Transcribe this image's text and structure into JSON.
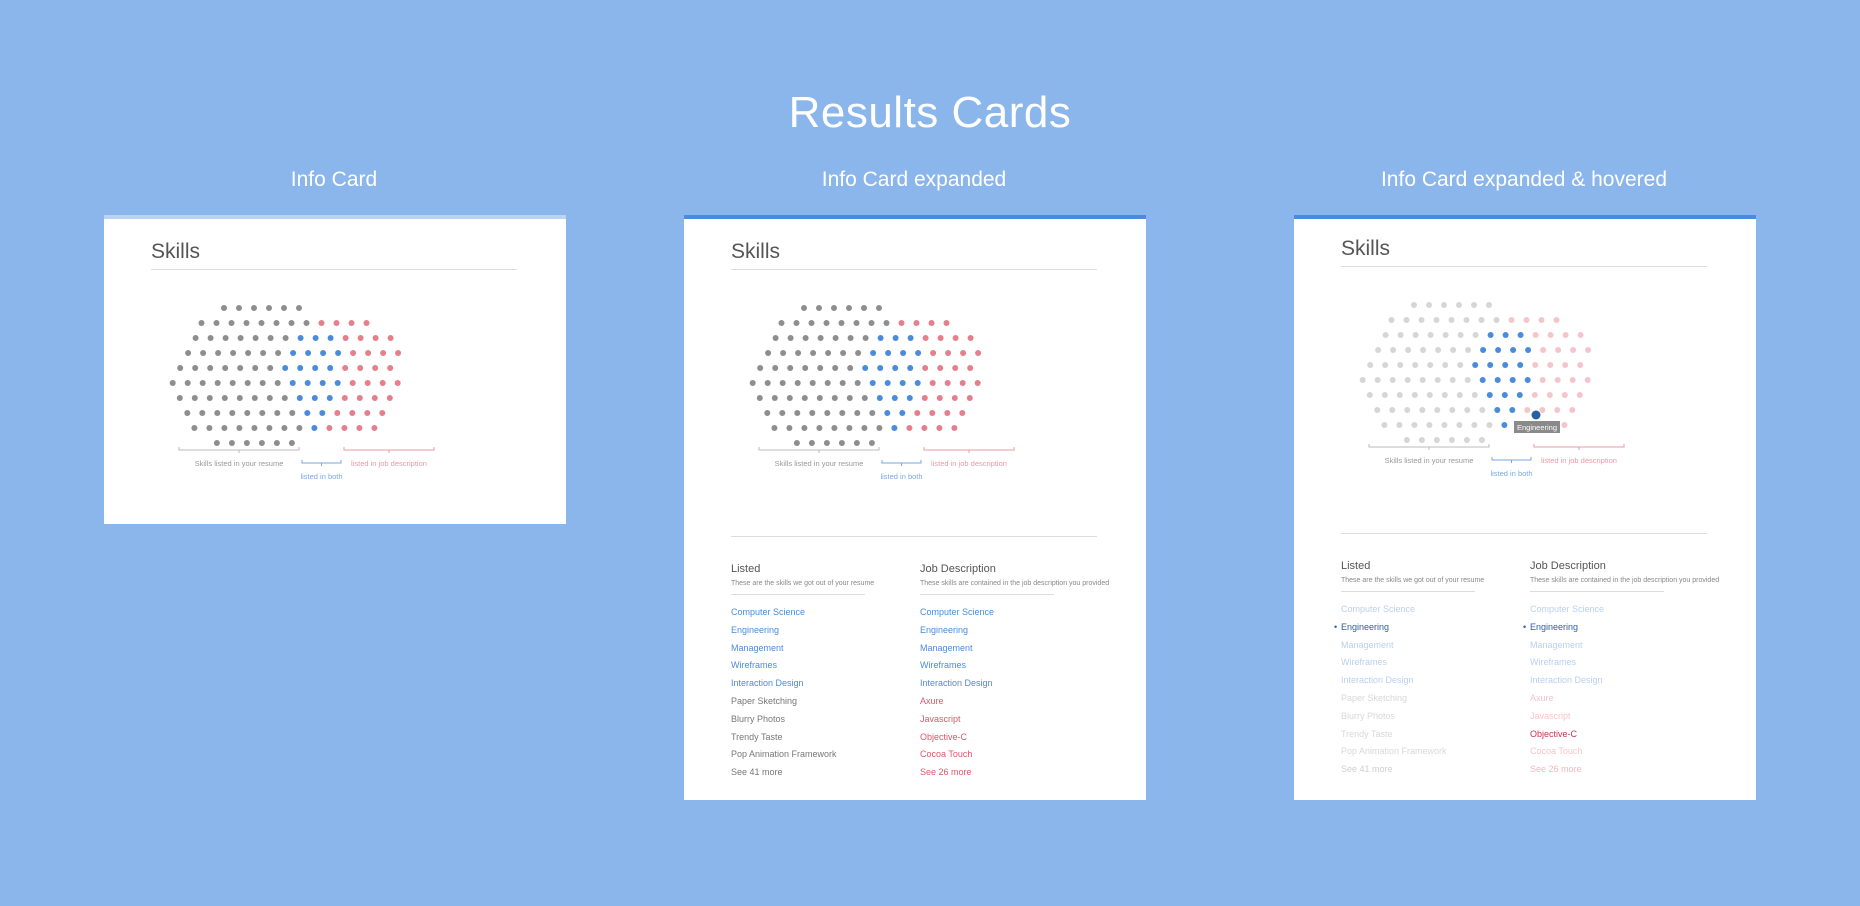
{
  "page": {
    "title": "Results Cards"
  },
  "columns": [
    {
      "title": "Info Card"
    },
    {
      "title": "Info Card expanded"
    },
    {
      "title": "Info Card expanded & hovered"
    }
  ],
  "colors": {
    "background": "#8ab6ec",
    "resume_dots": "#8e8e8e",
    "both_dots": "#4a8bdc",
    "job_dots": "#e57f8c",
    "accent_bar": "#4a8bdc",
    "accent_bar_light": "#b9d4f3"
  },
  "cards": [
    {
      "title": "Skills",
      "legend": {
        "resume": "Skills listed in your resume",
        "both": "listed in both",
        "job": "listed in job description"
      }
    },
    {
      "title": "Skills",
      "legend": {
        "resume": "Skills listed in your resume",
        "both": "listed in both",
        "job": "listed in job description"
      },
      "listed": {
        "heading": "Listed",
        "subheading": "These are the skills we got out of your resume",
        "items": [
          "Computer Science",
          "Engineering",
          "Management",
          "Wireframes",
          "Interaction Design",
          "Paper Sketching",
          "Blurry Photos",
          "Trendy Taste",
          "Pop Animation Framework"
        ],
        "more": "See 41 more"
      },
      "job": {
        "heading": "Job Description",
        "subheading": "These skills are contained in the job description you provided",
        "items": [
          "Computer Science",
          "Engineering",
          "Management",
          "Wireframes",
          "Interaction Design",
          "Axure",
          "Javascript",
          "Objective-C",
          "Cocoa Touch"
        ],
        "more": "See 26 more"
      }
    },
    {
      "title": "Skills",
      "legend": {
        "resume": "Skills listed in your resume",
        "both": "listed in both",
        "job": "listed in job description"
      },
      "tooltip": "Engineering",
      "listed": {
        "heading": "Listed",
        "subheading": "These are the skills we got out of your resume",
        "items": [
          "Computer Science",
          "Engineering",
          "Management",
          "Wireframes",
          "Interaction Design",
          "Paper Sketching",
          "Blurry Photos",
          "Trendy Taste",
          "Pop Animation Framework"
        ],
        "more": "See 41 more"
      },
      "job": {
        "heading": "Job Description",
        "subheading": "These skills are contained in the job description you provided",
        "items": [
          "Computer Science",
          "Engineering",
          "Management",
          "Wireframes",
          "Interaction Design",
          "Axure",
          "Javascript",
          "Objective-C",
          "Cocoa Touch"
        ],
        "more": "See 26 more"
      }
    }
  ]
}
